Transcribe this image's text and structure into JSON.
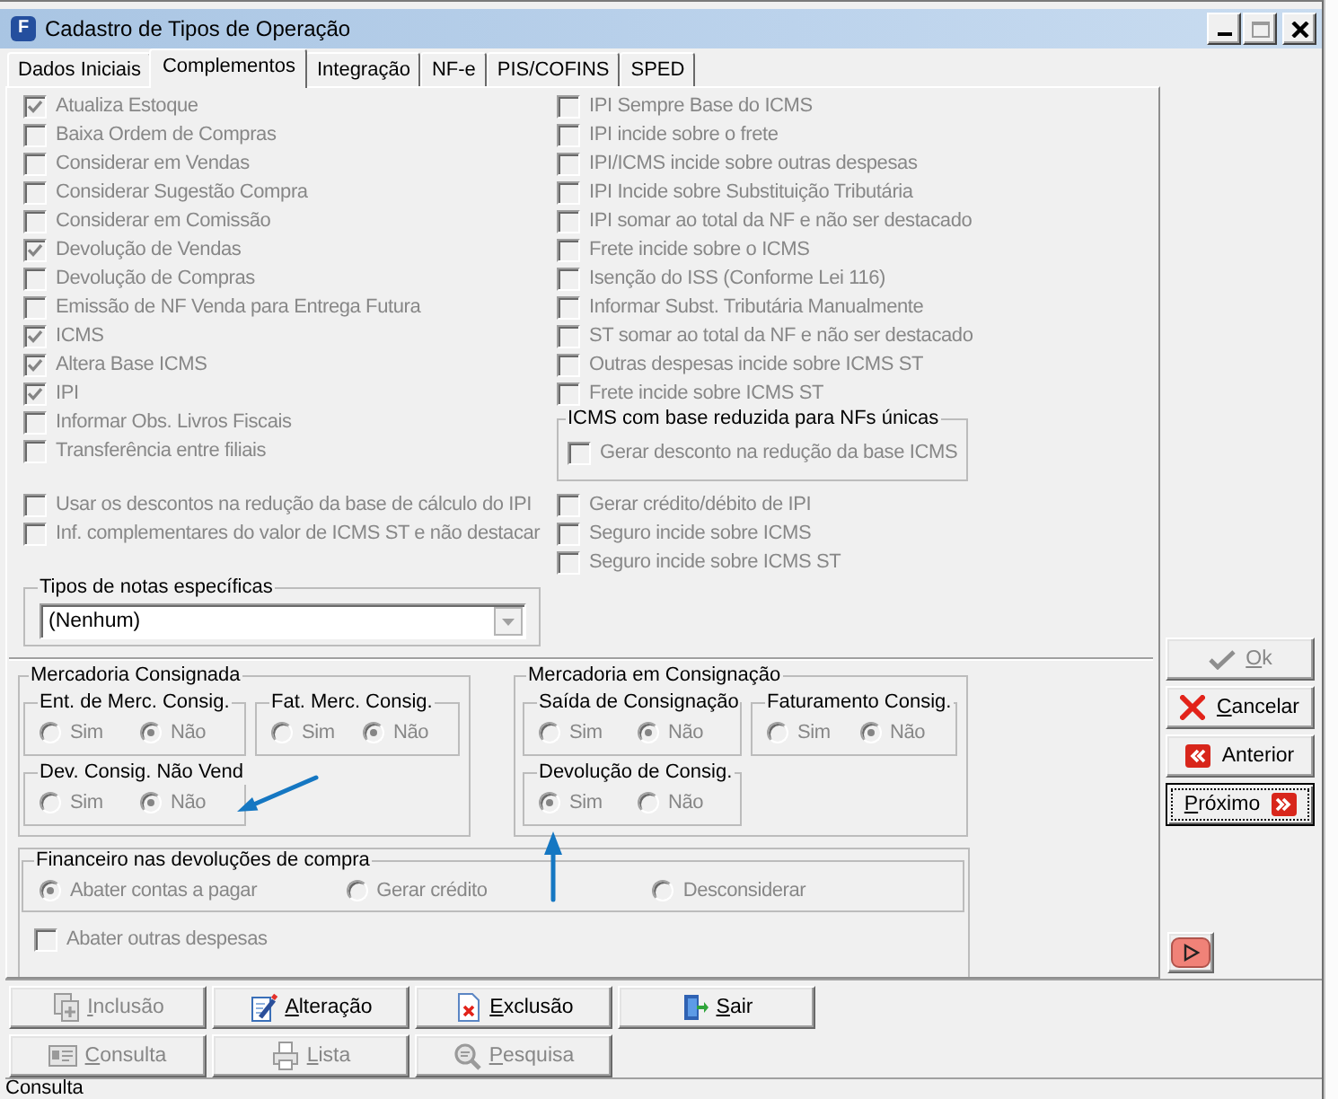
{
  "window": {
    "logo_letter": "F",
    "title": "Cadastro de Tipos de Operação"
  },
  "tabs": [
    {
      "label": "Dados Iniciais",
      "selected": false
    },
    {
      "label": "Complementos",
      "selected": true
    },
    {
      "label": "Integração",
      "selected": false
    },
    {
      "label": "NF-e",
      "selected": false
    },
    {
      "label": "PIS/COFINS",
      "selected": false
    },
    {
      "label": "SPED",
      "selected": false
    }
  ],
  "options_left": [
    {
      "label": "Atualiza Estoque",
      "checked": true,
      "disabled": true
    },
    {
      "label": "Baixa Ordem de Compras",
      "checked": false,
      "disabled": true
    },
    {
      "label": "Considerar em Vendas",
      "checked": false,
      "disabled": true
    },
    {
      "label": "Considerar Sugestão Compra",
      "checked": false,
      "disabled": true
    },
    {
      "label": "Considerar em Comissão",
      "checked": false,
      "disabled": true
    },
    {
      "label": "Devolução de Vendas",
      "checked": true,
      "disabled": true
    },
    {
      "label": "Devolução de Compras",
      "checked": false,
      "disabled": true
    },
    {
      "label": "Emissão de NF Venda para Entrega Futura",
      "checked": false,
      "disabled": true
    },
    {
      "label": "ICMS",
      "checked": true,
      "disabled": true
    },
    {
      "label": "Altera Base ICMS",
      "checked": true,
      "disabled": true
    },
    {
      "label": "IPI",
      "checked": true,
      "disabled": true
    },
    {
      "label": "Informar Obs. Livros Fiscais",
      "checked": false,
      "disabled": true
    },
    {
      "label": "Transferência entre filiais",
      "checked": false,
      "disabled": true
    }
  ],
  "options_right": [
    {
      "label": "IPI Sempre Base do ICMS",
      "checked": false,
      "disabled": true
    },
    {
      "label": "IPI incide sobre o frete",
      "checked": false,
      "disabled": true
    },
    {
      "label": "IPI/ICMS incide sobre outras despesas",
      "checked": false,
      "disabled": true
    },
    {
      "label": "IPI Incide sobre Substituição Tributária",
      "checked": false,
      "disabled": true
    },
    {
      "label": "IPI somar ao total da NF e não ser destacado",
      "checked": false,
      "disabled": true
    },
    {
      "label": "Frete incide sobre o ICMS",
      "checked": false,
      "disabled": true
    },
    {
      "label": "Isenção do ISS (Conforme Lei 116)",
      "checked": false,
      "disabled": true
    },
    {
      "label": "Informar Subst. Tributária Manualmente",
      "checked": false,
      "disabled": true
    },
    {
      "label": "ST somar ao total da NF e não ser destacado",
      "checked": false,
      "disabled": true
    },
    {
      "label": "Outras despesas incide sobre ICMS ST",
      "checked": false,
      "disabled": true
    },
    {
      "label": "Frete incide sobre ICMS ST",
      "checked": false,
      "disabled": true
    }
  ],
  "icms_reduced_base": {
    "title": "ICMS com base reduzida para NFs únicas",
    "options": [
      {
        "label": "Gerar desconto na redução da base ICMS",
        "checked": false,
        "disabled": true
      }
    ]
  },
  "options_left_lower": [
    {
      "label": "Usar os descontos na redução da base de cálculo do IPI",
      "checked": false,
      "disabled": true
    },
    {
      "label": "Inf. complementares do valor de ICMS ST e não destacar",
      "checked": false,
      "disabled": true
    }
  ],
  "options_right_lower": [
    {
      "label": "Gerar crédito/débito de IPI",
      "checked": false,
      "disabled": true
    },
    {
      "label": "Seguro incide sobre ICMS",
      "checked": false,
      "disabled": true
    },
    {
      "label": "Seguro incide sobre ICMS ST",
      "checked": false,
      "disabled": true
    }
  ],
  "note_types": {
    "title": "Tipos de notas específicas",
    "value": "(Nenhum)"
  },
  "consigned_goods": {
    "title": "Mercadoria Consignada",
    "groups": [
      {
        "title": "Ent. de Merc. Consig.",
        "options": [
          {
            "label": "Sim",
            "selected": false,
            "disabled": true
          },
          {
            "label": "Não",
            "selected": true,
            "disabled": true
          }
        ]
      },
      {
        "title": "Fat. Merc. Consig.",
        "options": [
          {
            "label": "Sim",
            "selected": false,
            "disabled": true
          },
          {
            "label": "Não",
            "selected": true,
            "disabled": true
          }
        ]
      },
      {
        "title": "Dev. Consig. Não Vend",
        "options": [
          {
            "label": "Sim",
            "selected": false,
            "disabled": true
          },
          {
            "label": "Não",
            "selected": true,
            "disabled": true
          }
        ]
      }
    ]
  },
  "goods_in_consignment": {
    "title": "Mercadoria em Consignação",
    "groups": [
      {
        "title": "Saída de Consignação",
        "options": [
          {
            "label": "Sim",
            "selected": false,
            "disabled": true
          },
          {
            "label": "Não",
            "selected": true,
            "disabled": true
          }
        ]
      },
      {
        "title": "Faturamento Consig.",
        "options": [
          {
            "label": "Sim",
            "selected": false,
            "disabled": true
          },
          {
            "label": "Não",
            "selected": true,
            "disabled": true
          }
        ]
      },
      {
        "title": "Devolução de Consig.",
        "options": [
          {
            "label": "Sim",
            "selected": true,
            "disabled": true
          },
          {
            "label": "Não",
            "selected": false,
            "disabled": true
          }
        ]
      }
    ]
  },
  "purchase_returns": {
    "title": "Financeiro nas devoluções de compra",
    "options": [
      {
        "label": "Abater contas a pagar",
        "selected": true,
        "disabled": true
      },
      {
        "label": "Gerar crédito",
        "selected": false,
        "disabled": true
      },
      {
        "label": "Desconsiderar",
        "selected": false,
        "disabled": true
      }
    ],
    "extra_options": [
      {
        "label": "Abater outras despesas",
        "checked": false,
        "disabled": true
      }
    ]
  },
  "side_buttons": [
    {
      "kind": "ok",
      "label": "Ok",
      "underlined_initial": true,
      "disabled": true,
      "focused": false
    },
    {
      "kind": "cancel",
      "label": "Cancelar",
      "underlined_initial": true,
      "disabled": false,
      "focused": false
    },
    {
      "kind": "previous",
      "label": "Anterior",
      "underlined_initial": false,
      "disabled": false,
      "focused": false
    },
    {
      "kind": "next",
      "label": "Próximo",
      "underlined_initial": true,
      "disabled": false,
      "focused": true
    }
  ],
  "toolbar_buttons": [
    {
      "kind": "add",
      "label": "Inclusão",
      "underlined_initial": true,
      "disabled": true
    },
    {
      "kind": "edit",
      "label": "Alteração",
      "underlined_initial": true,
      "disabled": false
    },
    {
      "kind": "delete",
      "label": "Exclusão",
      "underlined_initial": true,
      "disabled": false
    },
    {
      "kind": "exit",
      "label": "Sair",
      "underlined_initial": true,
      "disabled": false
    },
    {
      "kind": "view",
      "label": "Consulta",
      "underlined_initial": true,
      "disabled": true
    },
    {
      "kind": "list",
      "label": "Lista",
      "underlined_initial": true,
      "disabled": true
    },
    {
      "kind": "search",
      "label": "Pesquisa",
      "underlined_initial": true,
      "disabled": true
    }
  ],
  "status_bar": {
    "text": "Consulta"
  }
}
